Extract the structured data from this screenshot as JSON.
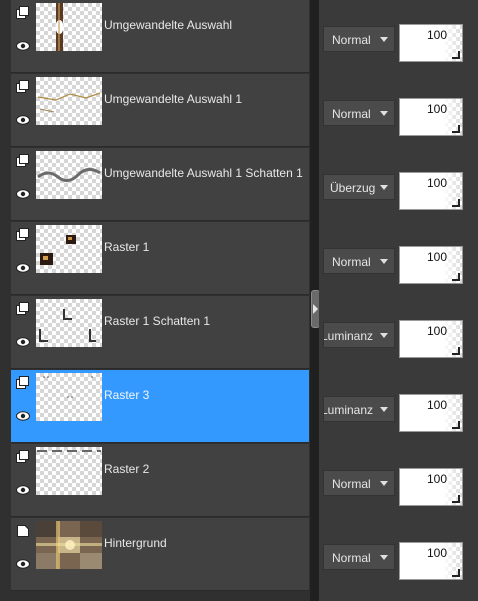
{
  "layers": [
    {
      "name": "Umgewandelte Auswahl",
      "blend": "Normal",
      "opacity": 100,
      "selected": false,
      "thumb": "vertical-frame",
      "group_icon": "group-layer-icon"
    },
    {
      "name": "Umgewandelte Auswahl 1",
      "blend": "Normal",
      "opacity": 100,
      "selected": false,
      "thumb": "thin-lines",
      "group_icon": "group-layer-icon"
    },
    {
      "name": "Umgewandelte Auswahl 1 Schatten 1",
      "blend": "Überzug",
      "opacity": 100,
      "selected": false,
      "thumb": "wavy-shadow",
      "group_icon": "group-layer-icon"
    },
    {
      "name": "Raster 1",
      "blend": "Normal",
      "opacity": 100,
      "selected": false,
      "thumb": "image-corners",
      "group_icon": "group-layer-icon"
    },
    {
      "name": "Raster 1 Schatten 1",
      "blend": "Luminanz (Vorversion)",
      "opacity": 100,
      "selected": false,
      "thumb": "corner-marks",
      "group_icon": "group-layer-icon"
    },
    {
      "name": "Raster 3",
      "blend": "Luminanz (Vorversion)",
      "opacity": 100,
      "selected": true,
      "thumb": "tiny-dots",
      "group_icon": "group-layer-icon"
    },
    {
      "name": "Raster 2",
      "blend": "Normal",
      "opacity": 100,
      "selected": false,
      "thumb": "dashed-line",
      "group_icon": "group-layer-icon"
    },
    {
      "name": "Hintergrund",
      "blend": "Normal",
      "opacity": 100,
      "selected": false,
      "thumb": "background-photo",
      "group_icon": "background-layer-icon"
    }
  ],
  "colors": {
    "panel": "#414141",
    "selected": "#3399ff",
    "text": "#e8e8e8"
  }
}
